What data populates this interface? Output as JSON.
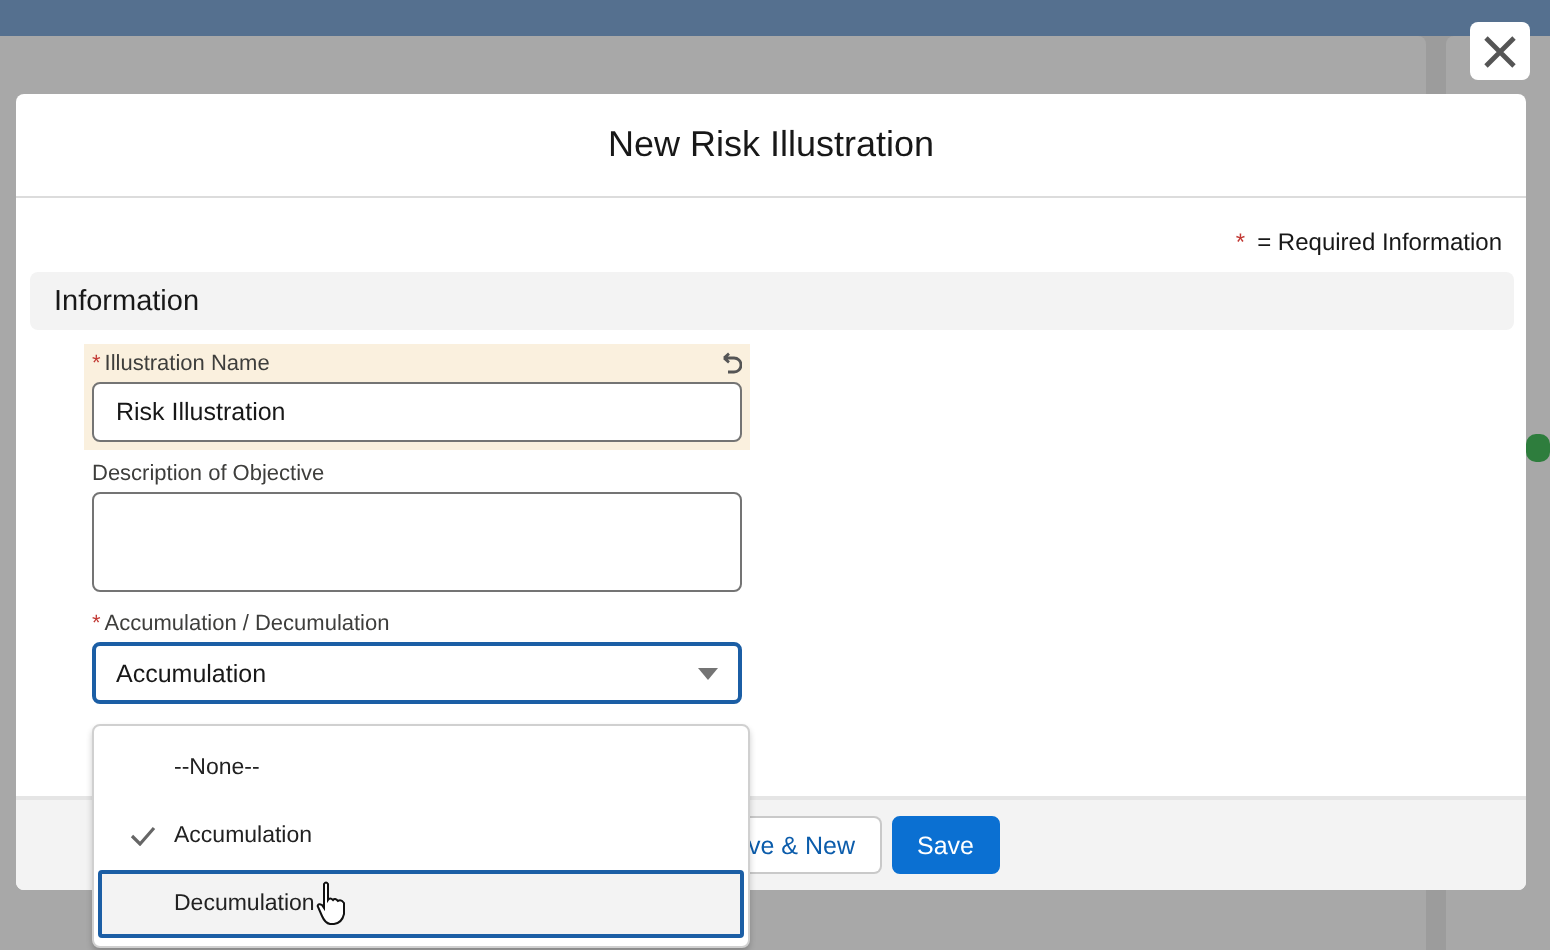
{
  "modal": {
    "title": "New Risk Illustration",
    "required_mark": "*",
    "required_note": "= Required Information",
    "section": "Information",
    "fields": [
      {
        "kind": "text",
        "label": "Illustration Name",
        "required": true,
        "value": "Risk Illustration",
        "edited": true
      },
      {
        "kind": "textarea",
        "label": "Description of Objective",
        "required": false,
        "edited": false
      },
      {
        "kind": "select",
        "label": "Accumulation / Decumulation",
        "required": true,
        "value": "Accumulation",
        "edited": false,
        "focused": true
      }
    ],
    "dropdown": {
      "options": [
        {
          "label": "--None--",
          "checked": false,
          "selected": false
        },
        {
          "label": "Accumulation",
          "checked": true,
          "selected": false
        },
        {
          "label": "Decumulation",
          "checked": false,
          "selected": true
        }
      ]
    },
    "buttons": [
      {
        "label": "ve & New",
        "kind": "neutral"
      },
      {
        "label": "Save",
        "kind": "brand"
      }
    ]
  }
}
